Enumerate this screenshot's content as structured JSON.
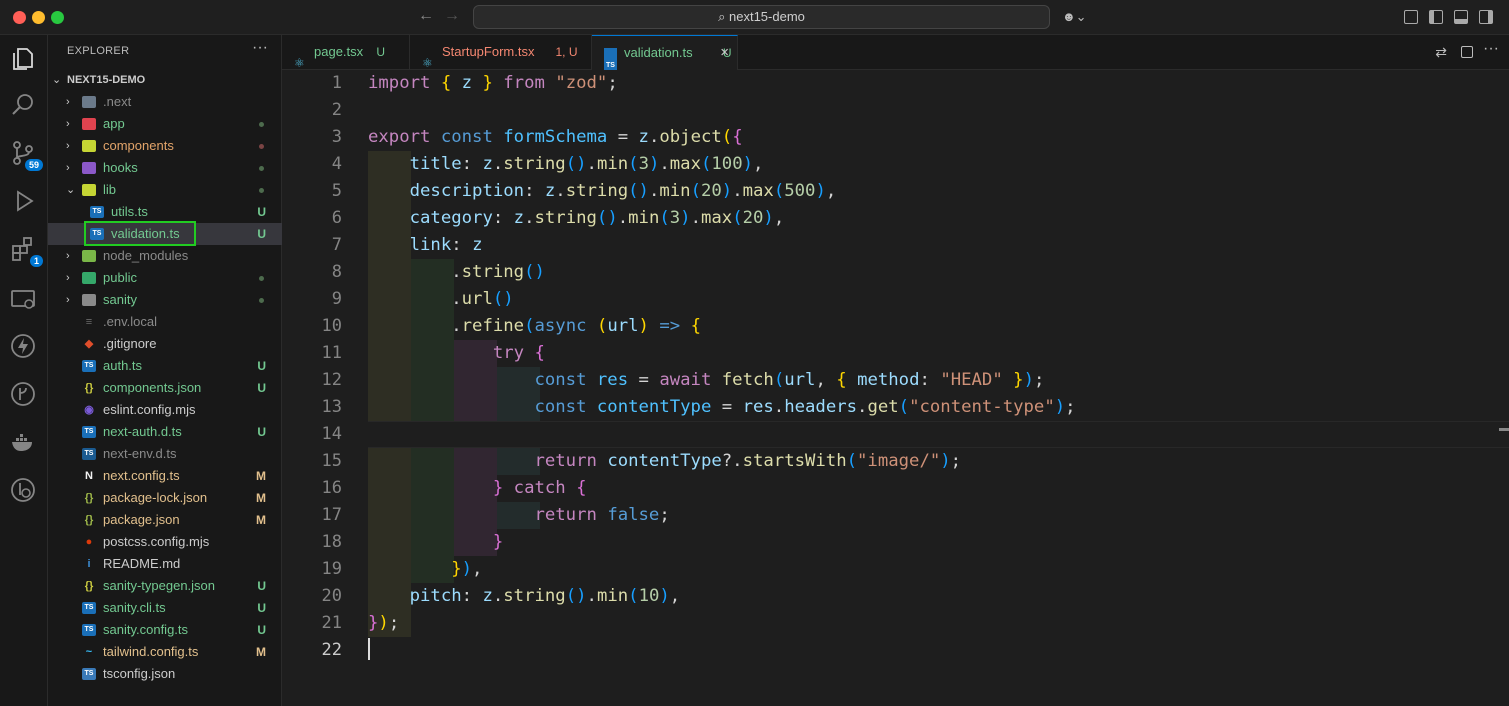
{
  "window": {
    "search": "next15-demo"
  },
  "activity": {
    "source_control_badge": "59",
    "extensions_badge": "1"
  },
  "explorer": {
    "header": "EXPLORER",
    "more": "···",
    "project": "NEXT15-DEMO",
    "items": [
      {
        "label": "next",
        "prefix": ".",
        "kind": "folder",
        "color": "#8a8a8a",
        "icon_color": "#6b7a8a"
      },
      {
        "label": "app",
        "kind": "folder",
        "color": "#73c991",
        "icon_color": "#e0434f",
        "status": "dot"
      },
      {
        "label": "components",
        "kind": "folder",
        "color": "#e2a46a",
        "icon_color": "#c5d534",
        "status": "dotred"
      },
      {
        "label": "hooks",
        "kind": "folder",
        "color": "#73c991",
        "icon_color": "#8b58c8",
        "status": "dot"
      },
      {
        "label": "lib",
        "kind": "folder",
        "color": "#73c991",
        "icon_color": "#c5d534",
        "status": "dot",
        "open": true
      },
      {
        "label": "utils.ts",
        "kind": "file",
        "indent": true,
        "color": "#73c991",
        "icon": "ts",
        "icon_color": "#1a6fb8",
        "status": "U"
      },
      {
        "label": "validation.ts",
        "kind": "file",
        "indent": true,
        "color": "#73c991",
        "icon": "ts",
        "icon_color": "#1a6fb8",
        "status": "U",
        "selected": true
      },
      {
        "label": "node_modules",
        "kind": "folder",
        "color": "#8a8a8a",
        "icon_color": "#7ab648"
      },
      {
        "label": "public",
        "kind": "folder",
        "color": "#73c991",
        "icon_color": "#35a86a",
        "status": "dot"
      },
      {
        "label": "sanity",
        "kind": "folder",
        "color": "#73c991",
        "icon_color": "#8a8a8a",
        "status": "dot"
      },
      {
        "label": "env.local",
        "prefix": ".",
        "kind": "file",
        "color": "#8a8a8a",
        "icon": "≡",
        "icon_color": "#6a6a6a"
      },
      {
        "label": "gitignore",
        "prefix": ".",
        "kind": "file",
        "color": "#cccccc",
        "icon": "◆",
        "icon_color": "#e04e2b"
      },
      {
        "label": "auth.ts",
        "kind": "file",
        "color": "#73c991",
        "icon": "ts",
        "icon_color": "#1a6fb8",
        "status": "U"
      },
      {
        "label": "components.json",
        "kind": "file",
        "color": "#73c991",
        "icon": "{}",
        "icon_color": "#cbcb41",
        "status": "U"
      },
      {
        "label": "eslint.config.mjs",
        "kind": "file",
        "color": "#cccccc",
        "icon": "◉",
        "icon_color": "#7b5bd9"
      },
      {
        "label": "next-auth.d.ts",
        "kind": "file",
        "color": "#73c991",
        "icon": "ts",
        "icon_color": "#1a6fb8",
        "status": "U"
      },
      {
        "label": "next-env.d.ts",
        "kind": "file",
        "color": "#8a8a8a",
        "icon": "ts",
        "icon_color": "#1a5a90"
      },
      {
        "label": "next.config.ts",
        "kind": "file",
        "color": "#e2c08d",
        "icon": "N",
        "icon_color": "#f2f2f2",
        "status": "M"
      },
      {
        "label": "package-lock.json",
        "kind": "file",
        "color": "#e2c08d",
        "icon": "{}",
        "icon_color": "#9fb94a",
        "status": "M"
      },
      {
        "label": "package.json",
        "kind": "file",
        "color": "#e2c08d",
        "icon": "{}",
        "icon_color": "#9fb94a",
        "status": "M"
      },
      {
        "label": "postcss.config.mjs",
        "kind": "file",
        "color": "#cccccc",
        "icon": "●",
        "icon_color": "#dd3a0a"
      },
      {
        "label": "README.md",
        "kind": "file",
        "color": "#cccccc",
        "icon": "i",
        "icon_color": "#3d8fd6"
      },
      {
        "label": "sanity-typegen.json",
        "kind": "file",
        "color": "#73c991",
        "icon": "{}",
        "icon_color": "#cbcb41",
        "status": "U"
      },
      {
        "label": "sanity.cli.ts",
        "kind": "file",
        "color": "#73c991",
        "icon": "ts",
        "icon_color": "#1a6fb8",
        "status": "U"
      },
      {
        "label": "sanity.config.ts",
        "kind": "file",
        "color": "#73c991",
        "icon": "ts",
        "icon_color": "#1a6fb8",
        "status": "U"
      },
      {
        "label": "tailwind.config.ts",
        "kind": "file",
        "color": "#e2c08d",
        "icon": "~",
        "icon_color": "#38bdf8",
        "status": "M"
      },
      {
        "label": "tsconfig.json",
        "kind": "file",
        "color": "#cccccc",
        "icon": "ts",
        "icon_color": "#3a7ab8"
      }
    ]
  },
  "tabs": [
    {
      "label": "page.tsx",
      "status": "U",
      "icon": "⚛",
      "icon_color": "#4fb8d8",
      "label_color": "#73c991",
      "status_color": "#73c991"
    },
    {
      "label": "StartupForm.tsx",
      "status": "1, U",
      "icon": "⚛",
      "icon_color": "#4fb8d8",
      "label_color": "#f48771",
      "status_color": "#f48771"
    },
    {
      "label": "validation.ts",
      "status": "U",
      "icon": "ts",
      "icon_color": "#1a6fb8",
      "label_color": "#73c991",
      "status_color": "#73c991",
      "active": true,
      "close": "×"
    }
  ],
  "editor": {
    "current_line": 22,
    "lines": [
      [
        [
          "k",
          "import"
        ],
        [
          "t",
          " "
        ],
        [
          "y",
          "{"
        ],
        [
          "t",
          " "
        ],
        [
          "v",
          "z"
        ],
        [
          "t",
          " "
        ],
        [
          "y",
          "}"
        ],
        [
          "t",
          " "
        ],
        [
          "k",
          "from"
        ],
        [
          "t",
          " "
        ],
        [
          "s",
          "\"zod\""
        ],
        [
          "t",
          ";"
        ]
      ],
      [],
      [
        [
          "k",
          "export"
        ],
        [
          "t",
          " "
        ],
        [
          "b",
          "const"
        ],
        [
          "t",
          " "
        ],
        [
          "c",
          "formSchema"
        ],
        [
          "t",
          " = "
        ],
        [
          "v",
          "z"
        ],
        [
          "t",
          "."
        ],
        [
          "f",
          "object"
        ],
        [
          "y",
          "("
        ],
        [
          "p",
          "{"
        ]
      ],
      [
        [
          "t",
          "    "
        ],
        [
          "v",
          "title"
        ],
        [
          "t",
          ": "
        ],
        [
          "v",
          "z"
        ],
        [
          "t",
          "."
        ],
        [
          "f",
          "string"
        ],
        [
          "q",
          "()"
        ],
        [
          "t",
          "."
        ],
        [
          "f",
          "min"
        ],
        [
          "q",
          "("
        ],
        [
          "n",
          "3"
        ],
        [
          "q",
          ")"
        ],
        [
          "t",
          "."
        ],
        [
          "f",
          "max"
        ],
        [
          "q",
          "("
        ],
        [
          "n",
          "100"
        ],
        [
          "q",
          ")"
        ],
        [
          "t",
          ","
        ]
      ],
      [
        [
          "t",
          "    "
        ],
        [
          "v",
          "description"
        ],
        [
          "t",
          ": "
        ],
        [
          "v",
          "z"
        ],
        [
          "t",
          "."
        ],
        [
          "f",
          "string"
        ],
        [
          "q",
          "()"
        ],
        [
          "t",
          "."
        ],
        [
          "f",
          "min"
        ],
        [
          "q",
          "("
        ],
        [
          "n",
          "20"
        ],
        [
          "q",
          ")"
        ],
        [
          "t",
          "."
        ],
        [
          "f",
          "max"
        ],
        [
          "q",
          "("
        ],
        [
          "n",
          "500"
        ],
        [
          "q",
          ")"
        ],
        [
          "t",
          ","
        ]
      ],
      [
        [
          "t",
          "    "
        ],
        [
          "v",
          "category"
        ],
        [
          "t",
          ": "
        ],
        [
          "v",
          "z"
        ],
        [
          "t",
          "."
        ],
        [
          "f",
          "string"
        ],
        [
          "q",
          "()"
        ],
        [
          "t",
          "."
        ],
        [
          "f",
          "min"
        ],
        [
          "q",
          "("
        ],
        [
          "n",
          "3"
        ],
        [
          "q",
          ")"
        ],
        [
          "t",
          "."
        ],
        [
          "f",
          "max"
        ],
        [
          "q",
          "("
        ],
        [
          "n",
          "20"
        ],
        [
          "q",
          ")"
        ],
        [
          "t",
          ","
        ]
      ],
      [
        [
          "t",
          "    "
        ],
        [
          "v",
          "link"
        ],
        [
          "t",
          ": "
        ],
        [
          "v",
          "z"
        ]
      ],
      [
        [
          "t",
          "        ."
        ],
        [
          "f",
          "string"
        ],
        [
          "q",
          "()"
        ]
      ],
      [
        [
          "t",
          "        ."
        ],
        [
          "f",
          "url"
        ],
        [
          "q",
          "()"
        ]
      ],
      [
        [
          "t",
          "        ."
        ],
        [
          "f",
          "refine"
        ],
        [
          "q",
          "("
        ],
        [
          "b",
          "async"
        ],
        [
          "t",
          " "
        ],
        [
          "y",
          "("
        ],
        [
          "v",
          "url"
        ],
        [
          "y",
          ")"
        ],
        [
          "t",
          " "
        ],
        [
          "b",
          "=>"
        ],
        [
          "t",
          " "
        ],
        [
          "y",
          "{"
        ]
      ],
      [
        [
          "t",
          "            "
        ],
        [
          "k",
          "try"
        ],
        [
          "t",
          " "
        ],
        [
          "p",
          "{"
        ]
      ],
      [
        [
          "t",
          "                "
        ],
        [
          "b",
          "const"
        ],
        [
          "t",
          " "
        ],
        [
          "c",
          "res"
        ],
        [
          "t",
          " = "
        ],
        [
          "k",
          "await"
        ],
        [
          "t",
          " "
        ],
        [
          "f",
          "fetch"
        ],
        [
          "q",
          "("
        ],
        [
          "v",
          "url"
        ],
        [
          "t",
          ", "
        ],
        [
          "y",
          "{"
        ],
        [
          "t",
          " "
        ],
        [
          "v",
          "method"
        ],
        [
          "t",
          ": "
        ],
        [
          "s",
          "\"HEAD\""
        ],
        [
          "t",
          " "
        ],
        [
          "y",
          "}"
        ],
        [
          "q",
          ")"
        ],
        [
          "t",
          ";"
        ]
      ],
      [
        [
          "t",
          "                "
        ],
        [
          "b",
          "const"
        ],
        [
          "t",
          " "
        ],
        [
          "c",
          "contentType"
        ],
        [
          "t",
          " = "
        ],
        [
          "v",
          "res"
        ],
        [
          "t",
          "."
        ],
        [
          "v",
          "headers"
        ],
        [
          "t",
          "."
        ],
        [
          "f",
          "get"
        ],
        [
          "q",
          "("
        ],
        [
          "s",
          "\"content-type\""
        ],
        [
          "q",
          ")"
        ],
        [
          "t",
          ";"
        ]
      ],
      [],
      [
        [
          "t",
          "                "
        ],
        [
          "k",
          "return"
        ],
        [
          "t",
          " "
        ],
        [
          "v",
          "contentType"
        ],
        [
          "t",
          "?."
        ],
        [
          "f",
          "startsWith"
        ],
        [
          "q",
          "("
        ],
        [
          "s",
          "\"image/\""
        ],
        [
          "q",
          ")"
        ],
        [
          "t",
          ";"
        ]
      ],
      [
        [
          "t",
          "            "
        ],
        [
          "p",
          "}"
        ],
        [
          "t",
          " "
        ],
        [
          "k",
          "catch"
        ],
        [
          "t",
          " "
        ],
        [
          "p",
          "{"
        ]
      ],
      [
        [
          "t",
          "                "
        ],
        [
          "k",
          "return"
        ],
        [
          "t",
          " "
        ],
        [
          "b",
          "false"
        ],
        [
          "t",
          ";"
        ]
      ],
      [
        [
          "t",
          "            "
        ],
        [
          "p",
          "}"
        ]
      ],
      [
        [
          "t",
          "        "
        ],
        [
          "y",
          "}"
        ],
        [
          "q",
          ")"
        ],
        [
          "t",
          ","
        ]
      ],
      [
        [
          "t",
          "    "
        ],
        [
          "v",
          "pitch"
        ],
        [
          "t",
          ": "
        ],
        [
          "v",
          "z"
        ],
        [
          "t",
          "."
        ],
        [
          "f",
          "string"
        ],
        [
          "q",
          "()"
        ],
        [
          "t",
          "."
        ],
        [
          "f",
          "min"
        ],
        [
          "q",
          "("
        ],
        [
          "n",
          "10"
        ],
        [
          "q",
          ")"
        ],
        [
          "t",
          ","
        ]
      ],
      [
        [
          "p",
          "}"
        ],
        [
          "y",
          ")"
        ],
        [
          "t",
          ";"
        ]
      ],
      []
    ]
  }
}
